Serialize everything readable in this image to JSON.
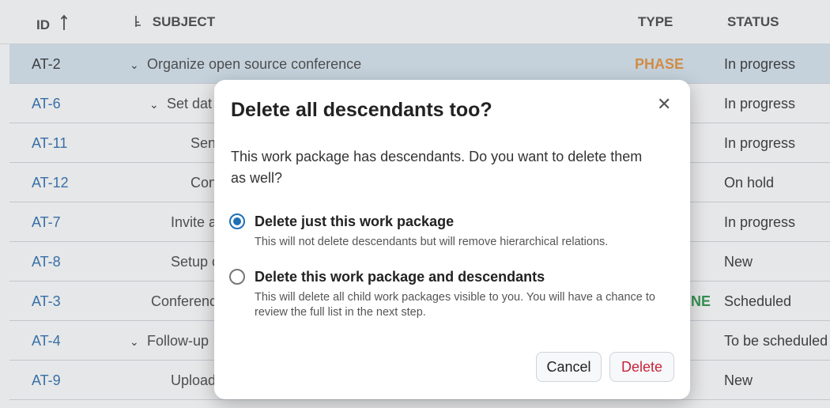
{
  "table": {
    "headers": {
      "id": "ID",
      "sort_icon": "arrow-up-icon",
      "subject_icon": "hierarchy-icon",
      "subject": "SUBJECT",
      "type": "TYPE",
      "status": "STATUS"
    },
    "rows": [
      {
        "id": "AT-2",
        "subject": "Organize open source conference",
        "type": "PHASE",
        "type_color": "#e89a4b",
        "status": "In progress",
        "selected": true,
        "caret": true
      },
      {
        "id": "AT-6",
        "subject": "Set dat",
        "type": "",
        "status": "In progress",
        "caret": true
      },
      {
        "id": "AT-11",
        "subject": "Sen",
        "type": "",
        "status": "In progress"
      },
      {
        "id": "AT-12",
        "subject": "Con",
        "type": "",
        "status": "On hold"
      },
      {
        "id": "AT-7",
        "subject": "Invite a",
        "type": "",
        "status": "In progress"
      },
      {
        "id": "AT-8",
        "subject": "Setup c",
        "type": "",
        "status": "New"
      },
      {
        "id": "AT-3",
        "subject": "Conferenc",
        "type": "NE",
        "type_color": "#3a9e55",
        "status": "Scheduled"
      },
      {
        "id": "AT-4",
        "subject": "Follow-up",
        "type": "",
        "status": "To be scheduled",
        "caret": true
      },
      {
        "id": "AT-9",
        "subject": "Upload",
        "type": "",
        "status": "New"
      }
    ]
  },
  "dialog": {
    "title": "Delete all descendants too?",
    "close_icon": "close-icon",
    "description": "This work package has descendants. Do you want to delete them as well?",
    "options": [
      {
        "label": "Delete just this work package",
        "hint": "This will not delete descendants but will remove hierarchical relations.",
        "checked": true
      },
      {
        "label": "Delete this work package and descendants",
        "hint": "This will delete all child work packages visible to you. You will have a chance to review the full list in the next step.",
        "checked": false
      }
    ],
    "cancel_label": "Cancel",
    "delete_label": "Delete"
  },
  "colors": {
    "accent": "#1f6fb5",
    "danger": "#c8243a",
    "link": "#3e7ab8"
  }
}
